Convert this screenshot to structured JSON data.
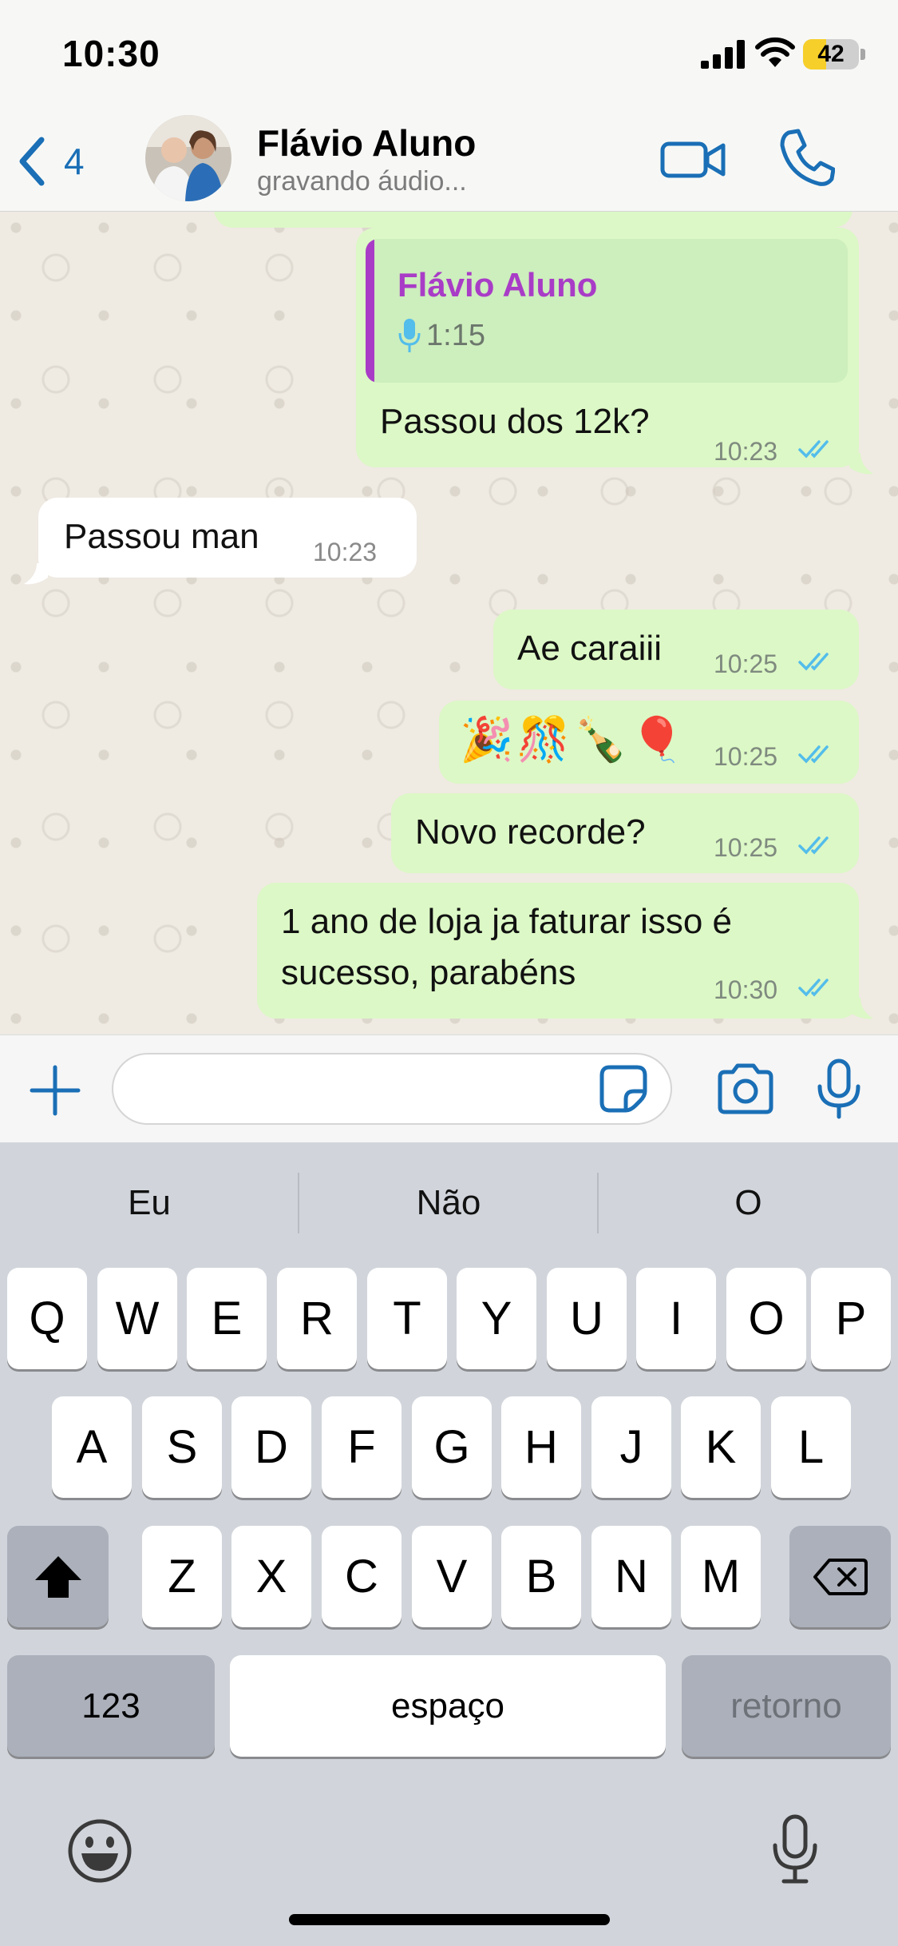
{
  "status_bar": {
    "time": "10:30",
    "battery_level": "42",
    "battery_fraction": 0.42,
    "battery_color": "#f6cf2b"
  },
  "header": {
    "back_count": "4",
    "contact_name": "Flávio Aluno",
    "contact_status": "gravando áudio...",
    "icons": [
      "chevron-left-icon",
      "video-camera-icon",
      "phone-icon"
    ]
  },
  "messages": [
    {
      "direction": "outgoing",
      "quoted": {
        "sender": "Flávio Aluno",
        "type": "audio",
        "duration": "1:15"
      },
      "text": "Passou dos 12k?",
      "time": "10:23",
      "status": "read"
    },
    {
      "direction": "incoming",
      "text": "Passou man",
      "time": "10:23"
    },
    {
      "direction": "outgoing",
      "text": "Ae caraiii",
      "time": "10:25",
      "status": "read"
    },
    {
      "direction": "outgoing",
      "text": "🎉🎊🍾🎈",
      "time": "10:25",
      "status": "read"
    },
    {
      "direction": "outgoing",
      "text": "Novo recorde?",
      "time": "10:25",
      "status": "read"
    },
    {
      "direction": "outgoing",
      "lines": [
        "1 ano de loja ja faturar isso é",
        "sucesso, parabéns"
      ],
      "time": "10:30",
      "status": "read"
    }
  ],
  "input_bar": {
    "placeholder": "",
    "icons": [
      "plus-icon",
      "sticker-icon",
      "camera-icon",
      "microphone-icon"
    ]
  },
  "keyboard": {
    "suggestions": [
      "Eu",
      "Não",
      "O"
    ],
    "row1": [
      "Q",
      "W",
      "E",
      "R",
      "T",
      "Y",
      "U",
      "I",
      "O",
      "P"
    ],
    "row2": [
      "A",
      "S",
      "D",
      "F",
      "G",
      "H",
      "J",
      "K",
      "L"
    ],
    "row3": [
      "Z",
      "X",
      "C",
      "V",
      "B",
      "N",
      "M"
    ],
    "numbers_label": "123",
    "space_label": "espaço",
    "return_label": "retorno"
  },
  "colors": {
    "accent": "#1a6fb6",
    "outgoing_bubble": "#dcf8c6",
    "incoming_bubble": "#ffffff",
    "quote_bar": "#a93cc7",
    "read_ticks": "#53bdeb",
    "chat_wallpaper": "#efeae2"
  }
}
